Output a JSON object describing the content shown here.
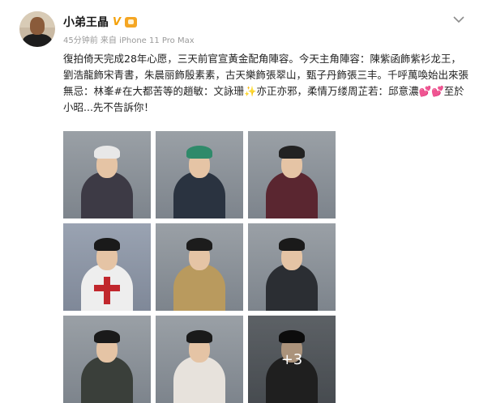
{
  "post": {
    "username": "小弟王晶",
    "verified_badge": "V",
    "meta": "45分钟前 来自 iPhone 11 Pro Max",
    "text": "復拍倚天完成28年心愿，三天前官宣黃金配角陣容。今天主角陣容：陳紫函飾紫衫龙王，劉浩龍飾宋青書，朱晨丽飾殷素素，古天樂飾張翠山，甄子丹飾張三丰。千呼萬喚始出來張無忌：林峯#在大都苦等的趙敏：文詠珊✨亦正亦邪，柔情万缕周芷若：邱意濃💕💕至於小昭...先不告訴你！",
    "more_count": "+3"
  },
  "icons": {
    "menu": "chevron-down-icon",
    "badge": "verified-v-icon",
    "crown": "member-crown-icon"
  },
  "photos": [
    {
      "name": "photo-1",
      "hair": "#e8e8e8",
      "body": "#3d3a45"
    },
    {
      "name": "photo-2",
      "hair": "#2f8a6a",
      "body": "#2a3340"
    },
    {
      "name": "photo-3",
      "hair": "#222222",
      "body": "#5a2630"
    },
    {
      "name": "photo-4",
      "hair": "#1a1a1a",
      "body": "#eeeeee"
    },
    {
      "name": "photo-5",
      "hair": "#1c1c1c",
      "body": "#b99a5e"
    },
    {
      "name": "photo-6",
      "hair": "#1a1a1a",
      "body": "#2b2e33"
    },
    {
      "name": "photo-7",
      "hair": "#1a1a1a",
      "body": "#3a3f3a"
    },
    {
      "name": "photo-8",
      "hair": "#1a1a1a",
      "body": "#e7e2dc"
    },
    {
      "name": "photo-9",
      "hair": "#111111",
      "body": "#2a2a2a"
    }
  ]
}
